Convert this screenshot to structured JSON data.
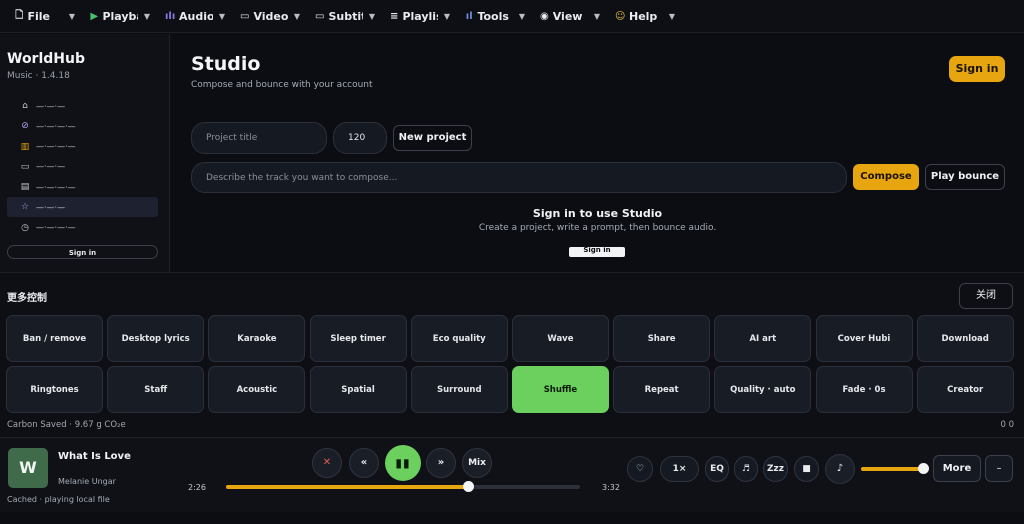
{
  "menubar": [
    {
      "label": "File",
      "icon": "file-icon",
      "glyph": "🗋"
    },
    {
      "label": "Playback",
      "icon": "play-icon",
      "glyph": "▶"
    },
    {
      "label": "Audio",
      "icon": "waveform-icon",
      "glyph": "ılı"
    },
    {
      "label": "Video",
      "icon": "video-icon",
      "glyph": "▭"
    },
    {
      "label": "Subtitle",
      "icon": "subtitle-icon",
      "glyph": "▭"
    },
    {
      "label": "Playlist",
      "icon": "list-icon",
      "glyph": "≡"
    },
    {
      "label": "Tools",
      "icon": "tools-icon",
      "glyph": "ıl"
    },
    {
      "label": "View",
      "icon": "eye-icon",
      "glyph": "◉"
    },
    {
      "label": "Help",
      "icon": "help-icon",
      "glyph": "☺"
    }
  ],
  "sidebar": {
    "brand": "WorldHub",
    "version": "Music · 1.4.18",
    "items": [
      {
        "label": "—·—·—",
        "icon": "home-icon",
        "glyph": "⌂"
      },
      {
        "label": "—·—·—·—",
        "icon": "compass-icon",
        "glyph": "⊘"
      },
      {
        "label": "—·—·—·—",
        "icon": "library-icon",
        "glyph": "▥"
      },
      {
        "label": "—·—·—",
        "icon": "monitor-icon",
        "glyph": "▭"
      },
      {
        "label": "—·—·—·—",
        "icon": "stack-icon",
        "glyph": "▤"
      },
      {
        "label": "—·—·—",
        "icon": "star-icon",
        "glyph": "☆"
      },
      {
        "label": "—·—·—·—",
        "icon": "clock-icon",
        "glyph": "◷"
      }
    ],
    "signin_label": "Sign in"
  },
  "studio": {
    "title": "Studio",
    "subtitle": "Compose and bounce with your account",
    "signin_label": "Sign in",
    "project_placeholder": "Project title",
    "bpm_value": "120",
    "new_project_label": "New project",
    "prompt_placeholder": "Describe the track you want to compose...",
    "compose_label": "Compose",
    "play_bounce_label": "Play bounce",
    "gate_title": "Sign in to use Studio",
    "gate_subtitle": "Create a project, write a prompt, then bounce audio.",
    "gate_button": "Sign in"
  },
  "controls": {
    "title": "更多控制",
    "close_label": "关闭",
    "tiles": [
      "Ban / remove",
      "Desktop lyrics",
      "Karaoke",
      "Sleep timer",
      "Eco quality",
      "Wave",
      "Share",
      "AI art",
      "Cover Hubi",
      "Download",
      "Ringtones",
      "Staff",
      "Acoustic",
      "Spatial",
      "Surround",
      "Shuffle",
      "Repeat",
      "Quality · auto",
      "Fade · 0s",
      "Creator"
    ],
    "active_tile": "Shuffle",
    "carbon": "Carbon Saved · 9.67 g CO₂e",
    "carbon_right": "0 0"
  },
  "player": {
    "art_letter": "W",
    "title": "What Is Love",
    "artist": "Melanie Ungar",
    "cache_status": "Cached · playing local file",
    "elapsed": "2:26",
    "duration": "3:32",
    "progress": 0.685,
    "volume": 1.0,
    "buttons": {
      "remove": "✕",
      "prev": "«",
      "play": "▮▮",
      "next": "»",
      "mix": "Mix",
      "heart": "♡",
      "speed": "1×",
      "eq": "EQ",
      "lyrics": "♬",
      "sleep": "Zzz",
      "stop": "■",
      "note": "♪",
      "more": "More",
      "dash": "–"
    }
  },
  "colors": {
    "accent": "#e7a50f",
    "active": "#6cd05e",
    "background": "#0b0d12"
  }
}
